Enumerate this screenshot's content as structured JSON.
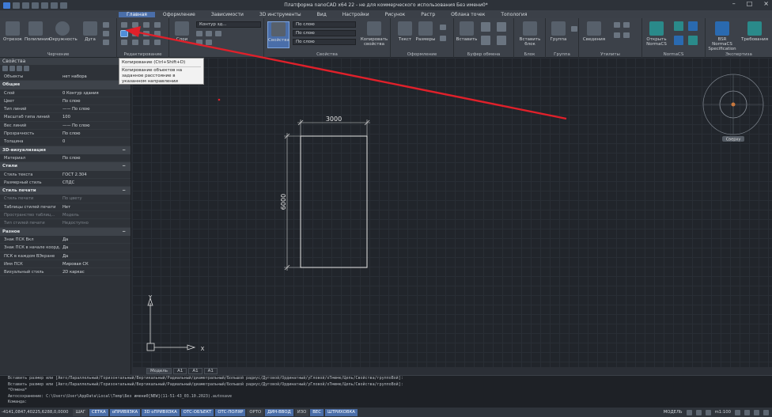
{
  "window": {
    "title": "Платформа nanoCAD x64 22 - не для коммерческого использования Без имени0*"
  },
  "menu": [
    "Главная",
    "Оформление",
    "Зависимости",
    "3D инструменты",
    "Вид",
    "Настройки",
    "Рисунок",
    "Растр",
    "Облака точек",
    "Топология"
  ],
  "ribbon": {
    "groups": [
      "Черчение",
      "Редактирование",
      "Свойства",
      "Оформление",
      "Буфер обмена",
      "Блок",
      "Группа",
      "Утилиты",
      "NormaCS",
      "Экспертиза"
    ],
    "buttons": {
      "line": "Отрезок",
      "polyline": "Полилиния",
      "circle": "Окружность",
      "arc": "Дуга",
      "layers": "Слои",
      "properties": "Свойства",
      "matchprop": "Копировать свойства",
      "text": "Текст",
      "dims": "Размеры",
      "paste": "Вставить",
      "insert_block": "Вставить блок",
      "group": "Группа",
      "measure": "Сведения",
      "open_normacs": "Открыть NormaCS",
      "bsr": "BSR NormaCS Specification",
      "requirements": "Требования"
    },
    "dropdowns": {
      "layer": "0",
      "contour": "Контур зд...",
      "color": "По слою",
      "ltype": "По слою",
      "lweight": "По слою",
      "lineweight2": "По слою"
    }
  },
  "tooltip": {
    "title": "Копирование (Ctrl+Shift+D)",
    "body": "Копирование объектов на заданное расстояние в указанном направлении"
  },
  "properties_panel": {
    "title": "Свойства",
    "selection": {
      "key": "Объекты",
      "value": "нет набора"
    },
    "sections": [
      {
        "name": "Общие",
        "rows": [
          {
            "k": "Слой",
            "v": "0   Контур здания"
          },
          {
            "k": "Цвет",
            "v": "По слою"
          },
          {
            "k": "Тип линий",
            "v": "—— По слою"
          },
          {
            "k": "Масштаб типа линий",
            "v": "100"
          },
          {
            "k": "Вес линий",
            "v": "—— По слою"
          },
          {
            "k": "Прозрачность",
            "v": "По слою"
          },
          {
            "k": "Толщина",
            "v": "0"
          }
        ]
      },
      {
        "name": "3D-визуализация",
        "rows": [
          {
            "k": "Материал",
            "v": "По слою"
          }
        ]
      },
      {
        "name": "Стили",
        "rows": [
          {
            "k": "Стиль текста",
            "v": "ГОСТ 2.304"
          },
          {
            "k": "Размерный стиль",
            "v": "СПДС"
          }
        ]
      },
      {
        "name": "Стиль печати",
        "rows": [
          {
            "k": "Стиль печати",
            "v": "По цвету",
            "muted": true
          },
          {
            "k": "Таблицы стилей печати",
            "v": "Нет"
          },
          {
            "k": "Пространство таблиц...",
            "v": "Модель",
            "muted": true
          },
          {
            "k": "Тип стилей печати",
            "v": "Недоступно",
            "muted": true
          }
        ]
      },
      {
        "name": "Разное",
        "rows": [
          {
            "k": "Знак ПСК Вкл",
            "v": "Да"
          },
          {
            "k": "Знак ПСК в начале коорд...",
            "v": "Да"
          },
          {
            "k": "ПСК в каждом ВЭкране",
            "v": "Да"
          },
          {
            "k": "Имя ПСК",
            "v": "Мировая СК"
          },
          {
            "k": "Визуальный стиль",
            "v": "2D каркас"
          }
        ]
      }
    ]
  },
  "drawing": {
    "dim_horizontal": "3000",
    "dim_vertical": "6000",
    "viewcube_label": "Сверху",
    "ucs_x": "X",
    "ucs_y": "Y"
  },
  "layout_tabs": [
    "Модель",
    "A1",
    "A1",
    "A1"
  ],
  "command_history": [
    "Вставить размер или [Авто/Параллельный/Горизонтальный/Вертикальный/Радиальный/диаметральный/Большой радиус/Дуговой/Ординатный/уГловой/оТмемк/Цепь/Свойства/группоВой]:",
    "Вставить размер или [Авто/Параллельный/Горизонтальный/Вертикальный/Радиальный/диаметральный/Большой радиус/Дуговой/Ординатный/уГловой/оТмемк/Цепь/Свойства/группоВой]:",
    "*Отмена*",
    "Автосохранение: C:\\Users\\User\\AppData\\Local\\Temp\\Без имени0[NEW](11-51-43_03.10.2023).autosave",
    "Команда:"
  ],
  "status": {
    "coords": "-4141,0847,40225,6288,0,0000",
    "toggles": [
      {
        "label": "ШАГ",
        "on": false
      },
      {
        "label": "СЕТКА",
        "on": true
      },
      {
        "label": "оПРИВЯЗКА",
        "on": true
      },
      {
        "label": "3D оПРИВЯЗКА",
        "on": true
      },
      {
        "label": "ОТС-ОБЪЕКТ",
        "on": true
      },
      {
        "label": "ОТС-ПОЛЯР",
        "on": true
      },
      {
        "label": "ОРТО",
        "on": false
      },
      {
        "label": "ДИН-ВВОД",
        "on": true
      },
      {
        "label": "ИЗО",
        "on": false
      },
      {
        "label": "ВЕС",
        "on": true
      },
      {
        "label": "ШТРИХОВКА",
        "on": true
      }
    ],
    "model": "МОДЕЛЬ",
    "scale": "m1:100"
  }
}
